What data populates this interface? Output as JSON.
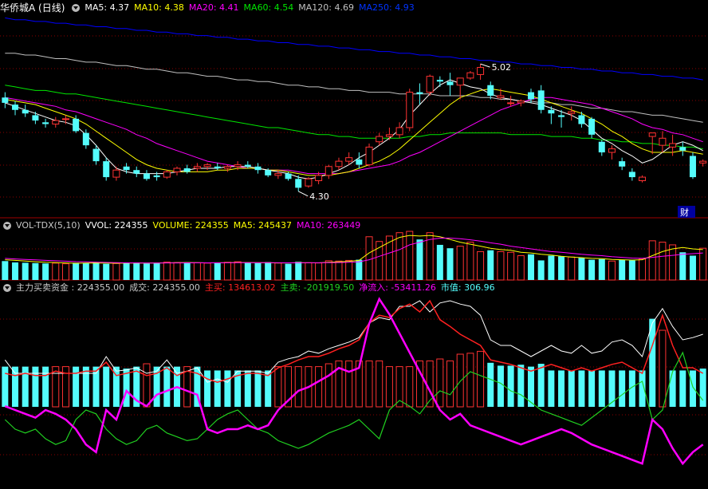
{
  "colors": {
    "bg": "#000000",
    "grid": "#8b0000",
    "sep": "#a00000",
    "up": "#ff3232",
    "down": "#54fcfc",
    "white": "#ffffff",
    "ma5": "#ffffff",
    "ma10": "#ffff00",
    "ma20": "#ff00ff",
    "ma60": "#00e600",
    "ma120": "#c0c0c0",
    "ma250": "#0000ff",
    "label": "#c8c8c8",
    "main_buy": "#ff2020",
    "main_sell": "#20d020",
    "net_in": "#ff00ff",
    "mcap": "#54fcfc"
  },
  "header_main": {
    "title": "华侨城A (日线)",
    "ma5": "MA5: 4.37",
    "ma10": "MA10: 4.38",
    "ma20": "MA20: 4.41",
    "ma60": "MA60: 4.54",
    "ma120": "MA120: 4.69",
    "ma250": "MA250: 4.93"
  },
  "header_vol": {
    "name": "VOL-TDX(5,10)",
    "vvol": "VVOL: 224355",
    "volume": "VOLUME: 224355",
    "ma5": "MA5: 245437",
    "ma10": "MA10: 263449"
  },
  "header_flow": {
    "name": "主力买卖资金 : 224355.00",
    "deal": "成交: 224355.00",
    "buy": "主买: 134613.02",
    "sell": "主卖: -201919.50",
    "net": "净流入: -53411.26",
    "mcap": "市值: 306.96"
  },
  "chart_data": {
    "type": "candlestick",
    "title": "华侨城A (日线)",
    "high_marker": "5.02",
    "low_marker": "4.30",
    "event_badge": "财",
    "price_ylim": [
      4.2,
      5.3
    ],
    "candles": [
      [
        4.83,
        4.86,
        4.77,
        4.8
      ],
      [
        4.79,
        4.81,
        4.73,
        4.76
      ],
      [
        4.76,
        4.79,
        4.72,
        4.74
      ],
      [
        4.73,
        4.75,
        4.68,
        4.7
      ],
      [
        4.69,
        4.71,
        4.66,
        4.68
      ],
      [
        4.68,
        4.72,
        4.66,
        4.7
      ],
      [
        4.71,
        4.73,
        4.68,
        4.71
      ],
      [
        4.71,
        4.73,
        4.63,
        4.64
      ],
      [
        4.63,
        4.65,
        4.54,
        4.56
      ],
      [
        4.54,
        4.56,
        4.45,
        4.47
      ],
      [
        4.47,
        4.49,
        4.36,
        4.38
      ],
      [
        4.38,
        4.44,
        4.36,
        4.42
      ],
      [
        4.44,
        4.46,
        4.4,
        4.42
      ],
      [
        4.42,
        4.44,
        4.38,
        4.4
      ],
      [
        4.4,
        4.42,
        4.36,
        4.37
      ],
      [
        4.39,
        4.41,
        4.36,
        4.38
      ],
      [
        4.38,
        4.42,
        4.37,
        4.41
      ],
      [
        4.41,
        4.44,
        4.39,
        4.43
      ],
      [
        4.43,
        4.45,
        4.4,
        4.41
      ],
      [
        4.43,
        4.46,
        4.41,
        4.44
      ],
      [
        4.44,
        4.46,
        4.42,
        4.45
      ],
      [
        4.44,
        4.46,
        4.42,
        4.43
      ],
      [
        4.43,
        4.45,
        4.41,
        4.44
      ],
      [
        4.44,
        4.47,
        4.42,
        4.45
      ],
      [
        4.45,
        4.47,
        4.43,
        4.44
      ],
      [
        4.44,
        4.46,
        4.4,
        4.42
      ],
      [
        4.42,
        4.43,
        4.38,
        4.39
      ],
      [
        4.39,
        4.42,
        4.37,
        4.4
      ],
      [
        4.4,
        4.41,
        4.36,
        4.37
      ],
      [
        4.37,
        4.39,
        4.3,
        4.32
      ],
      [
        4.33,
        4.38,
        4.32,
        4.37
      ],
      [
        4.36,
        4.41,
        4.34,
        4.39
      ],
      [
        4.39,
        4.45,
        4.37,
        4.44
      ],
      [
        4.44,
        4.49,
        4.42,
        4.47
      ],
      [
        4.47,
        4.52,
        4.45,
        4.49
      ],
      [
        4.48,
        4.52,
        4.43,
        4.45
      ],
      [
        4.45,
        4.57,
        4.44,
        4.55
      ],
      [
        4.58,
        4.63,
        4.56,
        4.61
      ],
      [
        4.61,
        4.66,
        4.59,
        4.62
      ],
      [
        4.62,
        4.69,
        4.6,
        4.66
      ],
      [
        4.66,
        4.88,
        4.64,
        4.86
      ],
      [
        4.86,
        4.91,
        4.79,
        4.85
      ],
      [
        4.86,
        4.96,
        4.84,
        4.95
      ],
      [
        4.93,
        4.95,
        4.89,
        4.92
      ],
      [
        4.92,
        4.97,
        4.84,
        4.9
      ],
      [
        4.9,
        4.92,
        4.82,
        4.94
      ],
      [
        4.94,
        4.98,
        4.93,
        4.97
      ],
      [
        4.96,
        5.02,
        4.93,
        5.0
      ],
      [
        4.9,
        4.92,
        4.82,
        4.84
      ],
      [
        4.83,
        4.88,
        4.82,
        4.84
      ],
      [
        4.8,
        4.84,
        4.78,
        4.8
      ],
      [
        4.8,
        4.82,
        4.78,
        4.81
      ],
      [
        4.86,
        4.88,
        4.8,
        4.82
      ],
      [
        4.87,
        4.9,
        4.74,
        4.76
      ],
      [
        4.76,
        4.78,
        4.68,
        4.74
      ],
      [
        4.73,
        4.76,
        4.66,
        4.72
      ],
      [
        4.74,
        4.78,
        4.7,
        4.75
      ],
      [
        4.73,
        4.75,
        4.66,
        4.68
      ],
      [
        4.71,
        4.72,
        4.6,
        4.62
      ],
      [
        4.58,
        4.59,
        4.5,
        4.52
      ],
      [
        4.52,
        4.56,
        4.48,
        4.54
      ],
      [
        4.47,
        4.49,
        4.42,
        4.44
      ],
      [
        4.41,
        4.43,
        4.36,
        4.38
      ],
      [
        4.36,
        4.39,
        4.35,
        4.38
      ],
      [
        4.61,
        4.63,
        4.51,
        4.63
      ],
      [
        4.56,
        4.64,
        4.52,
        4.6
      ],
      [
        4.55,
        4.62,
        4.5,
        4.57
      ],
      [
        4.55,
        4.58,
        4.5,
        4.53
      ],
      [
        4.5,
        4.52,
        4.37,
        4.38
      ],
      [
        4.46,
        4.48,
        4.44,
        4.47
      ]
    ],
    "ma5_series": [
      4.8,
      4.78,
      4.76,
      4.74,
      4.72,
      4.7,
      4.69,
      4.67,
      4.62,
      4.56,
      4.49,
      4.43,
      4.41,
      4.4,
      4.4,
      4.4,
      4.4,
      4.41,
      4.42,
      4.43,
      4.43,
      4.43,
      4.44,
      4.44,
      4.44,
      4.43,
      4.42,
      4.41,
      4.4,
      4.38,
      4.37,
      4.38,
      4.4,
      4.42,
      4.45,
      4.49,
      4.52,
      4.56,
      4.6,
      4.65,
      4.73,
      4.79,
      4.85,
      4.9,
      4.93,
      4.91,
      4.89,
      4.88,
      4.85,
      4.83,
      4.82,
      4.81,
      4.8,
      4.79,
      4.77,
      4.75,
      4.73,
      4.7,
      4.65,
      4.6,
      4.57,
      4.53,
      4.5,
      4.46,
      4.48,
      4.52,
      4.56,
      4.58,
      4.56,
      4.53
    ],
    "ma10_series": [
      4.82,
      4.81,
      4.8,
      4.79,
      4.77,
      4.75,
      4.73,
      4.71,
      4.68,
      4.64,
      4.6,
      4.56,
      4.52,
      4.48,
      4.45,
      4.43,
      4.42,
      4.41,
      4.41,
      4.41,
      4.41,
      4.42,
      4.42,
      4.43,
      4.43,
      4.43,
      4.42,
      4.42,
      4.41,
      4.4,
      4.39,
      4.39,
      4.39,
      4.4,
      4.41,
      4.43,
      4.45,
      4.47,
      4.5,
      4.54,
      4.59,
      4.64,
      4.69,
      4.74,
      4.79,
      4.83,
      4.85,
      4.87,
      4.88,
      4.87,
      4.86,
      4.85,
      4.84,
      4.82,
      4.8,
      4.78,
      4.76,
      4.74,
      4.71,
      4.68,
      4.64,
      4.61,
      4.57,
      4.54,
      4.52,
      4.52,
      4.52,
      4.53,
      4.52,
      4.51
    ],
    "ma20_series": [
      4.83,
      4.82,
      4.81,
      4.8,
      4.79,
      4.78,
      4.76,
      4.75,
      4.73,
      4.71,
      4.69,
      4.67,
      4.65,
      4.62,
      4.6,
      4.57,
      4.55,
      4.53,
      4.51,
      4.49,
      4.47,
      4.46,
      4.45,
      4.44,
      4.43,
      4.43,
      4.42,
      4.42,
      4.42,
      4.41,
      4.4,
      4.4,
      4.4,
      4.4,
      4.41,
      4.42,
      4.43,
      4.44,
      4.45,
      4.47,
      4.5,
      4.52,
      4.55,
      4.58,
      4.61,
      4.64,
      4.67,
      4.7,
      4.73,
      4.76,
      4.78,
      4.8,
      4.82,
      4.83,
      4.83,
      4.82,
      4.81,
      4.8,
      4.79,
      4.77,
      4.75,
      4.73,
      4.71,
      4.68,
      4.66,
      4.65,
      4.63,
      4.62,
      4.6,
      4.58
    ],
    "ma60_series": [
      4.9,
      4.89,
      4.88,
      4.87,
      4.87,
      4.86,
      4.85,
      4.85,
      4.84,
      4.83,
      4.82,
      4.81,
      4.8,
      4.79,
      4.78,
      4.77,
      4.76,
      4.75,
      4.74,
      4.73,
      4.72,
      4.71,
      4.7,
      4.69,
      4.68,
      4.67,
      4.66,
      4.66,
      4.65,
      4.64,
      4.63,
      4.62,
      4.62,
      4.61,
      4.61,
      4.6,
      4.6,
      4.6,
      4.6,
      4.6,
      4.61,
      4.61,
      4.62,
      4.62,
      4.63,
      4.63,
      4.63,
      4.63,
      4.63,
      4.63,
      4.62,
      4.62,
      4.62,
      4.62,
      4.61,
      4.61,
      4.61,
      4.6,
      4.6,
      4.59,
      4.59,
      4.58,
      4.58,
      4.57,
      4.57,
      4.56,
      4.56,
      4.55,
      4.55,
      4.54
    ],
    "ma120_series": [
      5.08,
      5.08,
      5.07,
      5.07,
      5.06,
      5.05,
      5.05,
      5.04,
      5.03,
      5.03,
      5.02,
      5.01,
      5.01,
      5.0,
      4.99,
      4.99,
      4.98,
      4.97,
      4.97,
      4.96,
      4.95,
      4.95,
      4.94,
      4.93,
      4.93,
      4.92,
      4.92,
      4.91,
      4.9,
      4.9,
      4.89,
      4.89,
      4.88,
      4.88,
      4.87,
      4.87,
      4.86,
      4.86,
      4.86,
      4.85,
      4.85,
      4.85,
      4.85,
      4.84,
      4.84,
      4.84,
      4.84,
      4.83,
      4.83,
      4.82,
      4.82,
      4.81,
      4.81,
      4.8,
      4.8,
      4.79,
      4.79,
      4.78,
      4.77,
      4.77,
      4.76,
      4.75,
      4.75,
      4.74,
      4.73,
      4.73,
      4.72,
      4.71,
      4.7,
      4.69
    ],
    "ma250_series": [
      5.28,
      5.27,
      5.27,
      5.26,
      5.26,
      5.25,
      5.25,
      5.24,
      5.24,
      5.23,
      5.23,
      5.22,
      5.22,
      5.21,
      5.21,
      5.2,
      5.2,
      5.19,
      5.19,
      5.18,
      5.18,
      5.17,
      5.17,
      5.16,
      5.16,
      5.15,
      5.15,
      5.14,
      5.14,
      5.13,
      5.13,
      5.12,
      5.12,
      5.11,
      5.11,
      5.1,
      5.1,
      5.09,
      5.09,
      5.08,
      5.08,
      5.07,
      5.07,
      5.06,
      5.06,
      5.05,
      5.05,
      5.04,
      5.04,
      5.03,
      5.03,
      5.02,
      5.02,
      5.01,
      5.01,
      5.0,
      5.0,
      4.99,
      4.99,
      4.98,
      4.98,
      4.97,
      4.97,
      4.96,
      4.96,
      4.95,
      4.95,
      4.94,
      4.94,
      4.93
    ],
    "volume": [
      280,
      260,
      255,
      250,
      245,
      250,
      240,
      255,
      250,
      260,
      240,
      245,
      250,
      260,
      245,
      250,
      265,
      258,
      262,
      255,
      250,
      248,
      262,
      270,
      260,
      250,
      265,
      252,
      240,
      270,
      255,
      252,
      285,
      280,
      290,
      300,
      640,
      570,
      650,
      700,
      720,
      600,
      700,
      520,
      470,
      500,
      560,
      420,
      440,
      420,
      410,
      360,
      380,
      290,
      360,
      350,
      340,
      330,
      300,
      310,
      280,
      300,
      290,
      310,
      580,
      560,
      520,
      410,
      360,
      470
    ],
    "vol_ma5": [
      300,
      290,
      280,
      270,
      262,
      258,
      252,
      248,
      250,
      252,
      250,
      248,
      250,
      252,
      250,
      252,
      254,
      256,
      258,
      256,
      254,
      255,
      256,
      258,
      259,
      257,
      255,
      253,
      252,
      256,
      255,
      254,
      262,
      268,
      276,
      290,
      400,
      480,
      560,
      630,
      660,
      650,
      660,
      640,
      600,
      560,
      530,
      500,
      470,
      450,
      440,
      410,
      400,
      380,
      370,
      350,
      340,
      330,
      320,
      315,
      305,
      300,
      295,
      300,
      360,
      420,
      460,
      480,
      460,
      450
    ],
    "vol_ma10": [
      320,
      312,
      305,
      298,
      290,
      284,
      278,
      272,
      268,
      264,
      260,
      256,
      254,
      252,
      251,
      251,
      252,
      253,
      254,
      254,
      254,
      254,
      255,
      256,
      257,
      257,
      256,
      255,
      254,
      255,
      255,
      255,
      256,
      258,
      262,
      268,
      300,
      350,
      400,
      450,
      520,
      560,
      600,
      620,
      620,
      610,
      595,
      575,
      550,
      530,
      500,
      480,
      460,
      440,
      420,
      410,
      395,
      380,
      370,
      360,
      345,
      335,
      325,
      320,
      335,
      350,
      365,
      380,
      390,
      400
    ],
    "flow_bars": [
      0.42,
      0.42,
      0.42,
      0.42,
      0.42,
      0.42,
      0.42,
      0.42,
      0.42,
      0.42,
      0.42,
      0.42,
      0.4,
      0.42,
      0.45,
      0.42,
      0.42,
      0.42,
      0.42,
      0.42,
      0.38,
      0.38,
      0.38,
      0.38,
      0.38,
      0.38,
      0.38,
      0.42,
      0.42,
      0.42,
      0.42,
      0.42,
      0.45,
      0.48,
      0.48,
      0.48,
      0.48,
      0.48,
      0.42,
      0.42,
      0.42,
      0.48,
      0.48,
      0.5,
      0.48,
      0.55,
      0.56,
      0.58,
      0.46,
      0.43,
      0.43,
      0.44,
      0.42,
      0.45,
      0.38,
      0.38,
      0.38,
      0.38,
      0.38,
      0.38,
      0.38,
      0.38,
      0.38,
      0.38,
      0.92,
      0.8,
      0.38,
      0.38,
      0.38,
      0.4
    ],
    "flow_bar_up": [
      false,
      false,
      false,
      false,
      false,
      true,
      true,
      false,
      false,
      false,
      false,
      false,
      false,
      false,
      true,
      false,
      false,
      false,
      true,
      false,
      false,
      false,
      false,
      false,
      false,
      false,
      false,
      true,
      true,
      true,
      true,
      true,
      true,
      true,
      true,
      true,
      true,
      true,
      true,
      true,
      true,
      true,
      true,
      true,
      true,
      true,
      true,
      true,
      false,
      false,
      false,
      false,
      false,
      false,
      false,
      false,
      false,
      false,
      false,
      false,
      false,
      false,
      false,
      false,
      false,
      true,
      false,
      false,
      false,
      false
    ],
    "flow_white": [
      0.42,
      0.3,
      0.3,
      0.3,
      0.3,
      0.3,
      0.3,
      0.3,
      0.3,
      0.3,
      0.45,
      0.32,
      0.33,
      0.35,
      0.3,
      0.32,
      0.42,
      0.3,
      0.32,
      0.35,
      0.22,
      0.25,
      0.22,
      0.32,
      0.32,
      0.32,
      0.3,
      0.4,
      0.43,
      0.45,
      0.5,
      0.48,
      0.52,
      0.55,
      0.58,
      0.62,
      0.75,
      0.8,
      0.78,
      0.9,
      0.9,
      0.95,
      0.85,
      0.93,
      0.95,
      0.92,
      0.9,
      0.82,
      0.6,
      0.55,
      0.55,
      0.5,
      0.45,
      0.5,
      0.55,
      0.5,
      0.48,
      0.55,
      0.48,
      0.5,
      0.58,
      0.6,
      0.55,
      0.45,
      0.75,
      0.88,
      0.72,
      0.6,
      0.62,
      0.65
    ],
    "flow_red": [
      0.3,
      0.28,
      0.3,
      0.28,
      0.28,
      0.32,
      0.3,
      0.3,
      0.32,
      0.32,
      0.4,
      0.28,
      0.3,
      0.32,
      0.28,
      0.3,
      0.35,
      0.28,
      0.32,
      0.3,
      0.25,
      0.22,
      0.25,
      0.28,
      0.3,
      0.3,
      0.28,
      0.35,
      0.38,
      0.42,
      0.45,
      0.45,
      0.48,
      0.52,
      0.55,
      0.6,
      0.75,
      0.82,
      0.8,
      0.88,
      0.92,
      0.85,
      0.95,
      0.78,
      0.72,
      0.65,
      0.6,
      0.55,
      0.42,
      0.4,
      0.38,
      0.35,
      0.32,
      0.35,
      0.38,
      0.35,
      0.32,
      0.35,
      0.32,
      0.35,
      0.38,
      0.4,
      0.35,
      0.3,
      0.55,
      0.82,
      0.55,
      0.35,
      0.35,
      0.3
    ],
    "flow_magenta": [
      0.42,
      0.4,
      0.38,
      0.36,
      0.4,
      0.38,
      0.35,
      0.3,
      0.22,
      0.18,
      0.4,
      0.35,
      0.5,
      0.45,
      0.42,
      0.48,
      0.5,
      0.52,
      0.5,
      0.48,
      0.3,
      0.28,
      0.3,
      0.3,
      0.32,
      0.3,
      0.32,
      0.4,
      0.45,
      0.5,
      0.52,
      0.55,
      0.58,
      0.62,
      0.6,
      0.62,
      0.85,
      0.98,
      0.9,
      0.8,
      0.7,
      0.6,
      0.5,
      0.4,
      0.35,
      0.38,
      0.32,
      0.3,
      0.28,
      0.26,
      0.24,
      0.22,
      0.24,
      0.26,
      0.28,
      0.3,
      0.28,
      0.25,
      0.22,
      0.2,
      0.18,
      0.16,
      0.14,
      0.12,
      0.35,
      0.3,
      0.2,
      0.12,
      0.18,
      0.22
    ],
    "flow_green": [
      0.35,
      0.3,
      0.28,
      0.3,
      0.25,
      0.22,
      0.24,
      0.35,
      0.4,
      0.38,
      0.3,
      0.25,
      0.22,
      0.24,
      0.3,
      0.32,
      0.28,
      0.26,
      0.24,
      0.25,
      0.3,
      0.35,
      0.38,
      0.4,
      0.35,
      0.3,
      0.28,
      0.24,
      0.22,
      0.2,
      0.22,
      0.25,
      0.28,
      0.3,
      0.32,
      0.35,
      0.3,
      0.25,
      0.4,
      0.45,
      0.42,
      0.38,
      0.45,
      0.5,
      0.48,
      0.55,
      0.6,
      0.58,
      0.56,
      0.54,
      0.5,
      0.48,
      0.44,
      0.4,
      0.38,
      0.36,
      0.34,
      0.32,
      0.36,
      0.4,
      0.44,
      0.48,
      0.52,
      0.55,
      0.35,
      0.4,
      0.6,
      0.7,
      0.52,
      0.45
    ]
  }
}
